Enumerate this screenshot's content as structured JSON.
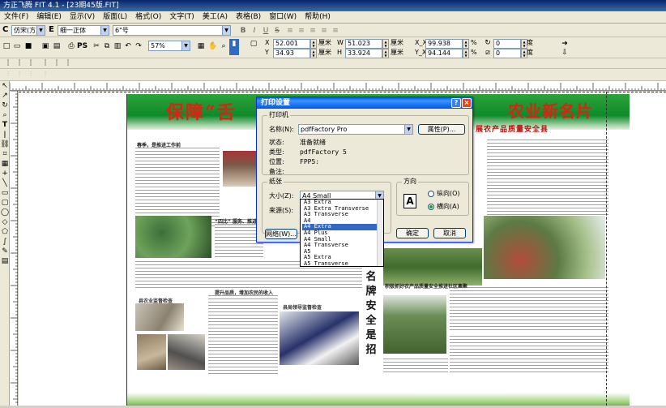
{
  "window": {
    "title": "方正飞腾 FIT 4.1 - [23期45版.FIT]"
  },
  "menu": [
    "文件(F)",
    "编辑(E)",
    "显示(V)",
    "版面(L)",
    "格式(O)",
    "文字(T)",
    "美工(A)",
    "表格(B)",
    "窗口(W)",
    "帮助(H)"
  ],
  "font_toolbar": {
    "c_label": "C",
    "chinese_font": "仿宋(方正)",
    "e_label": "E",
    "english_font": "细一正体",
    "size": "6\"号",
    "bold": "B",
    "italic": "I",
    "underline": "U",
    "strike": "S"
  },
  "std_toolbar": {
    "zoom": "57%",
    "ps_label": "PS"
  },
  "position": {
    "x_label": "X",
    "x_value": "52.001",
    "x_unit": "厘米",
    "y_label": "Y",
    "y_value": "34.93",
    "y_unit": "厘米",
    "w_label": "W",
    "w_value": "51.023",
    "w_unit": "厘米",
    "h_label": "H",
    "h_value": "33.924",
    "h_unit": "厘米",
    "sx_label": "X_X",
    "sx_value": "99.938",
    "sx_unit": "%",
    "sy_label": "Y_X",
    "sy_value": "94.144",
    "sy_unit": "%",
    "rot_value": "0",
    "rot_unit": "度",
    "skew_value": "0",
    "skew_unit": "度"
  },
  "newspaper": {
    "banner_left": "保障“舌",
    "banner_right": "农业新名片",
    "banner_sub": "展农产品质量安全县",
    "vertical_title": "名牌安全是招",
    "headlines": [
      "春季，是推进工作前",
      "“四比” 服务、推进农产品安全",
      "提升品质，增加农民的收入",
      "积极抓好农产品质量安全推进社区集聚",
      "严格推进农业标准化生产，加强农产品质量安全监管工作"
    ],
    "captions": [
      "县农业监督检查",
      "县局领导监督检查"
    ]
  },
  "dialog": {
    "title": "打印设置",
    "help": "?",
    "close": "×",
    "printer_group": "打印机",
    "name_label": "名称(N):",
    "name_value": "pdfFactory Pro",
    "properties": "属性(P)...",
    "status_label": "状态:",
    "status_value": "准备就绪",
    "type_label": "类型:",
    "type_value": "pdfFactory 5",
    "where_label": "位置:",
    "where_value": "FPP5:",
    "comment_label": "备注:",
    "comment_value": "",
    "paper_group": "纸张",
    "size_label": "大小(Z):",
    "size_value": "A4 Small",
    "source_label": "来源(S):",
    "network_button": "网络(W)...",
    "orientation_group": "方向",
    "portrait": "纵向(O)",
    "landscape": "横向(A)",
    "ok": "确定",
    "cancel": "取消",
    "paper_options": [
      "A3 Extra",
      "A3 Extra Transverse",
      "A3 Transverse",
      "A4",
      "A4 Extra",
      "A4 Plus",
      "A4 Small",
      "A4 Transverse",
      "A5",
      "A5 Extra",
      "A5 Transverse"
    ],
    "paper_selected_index": 4
  }
}
